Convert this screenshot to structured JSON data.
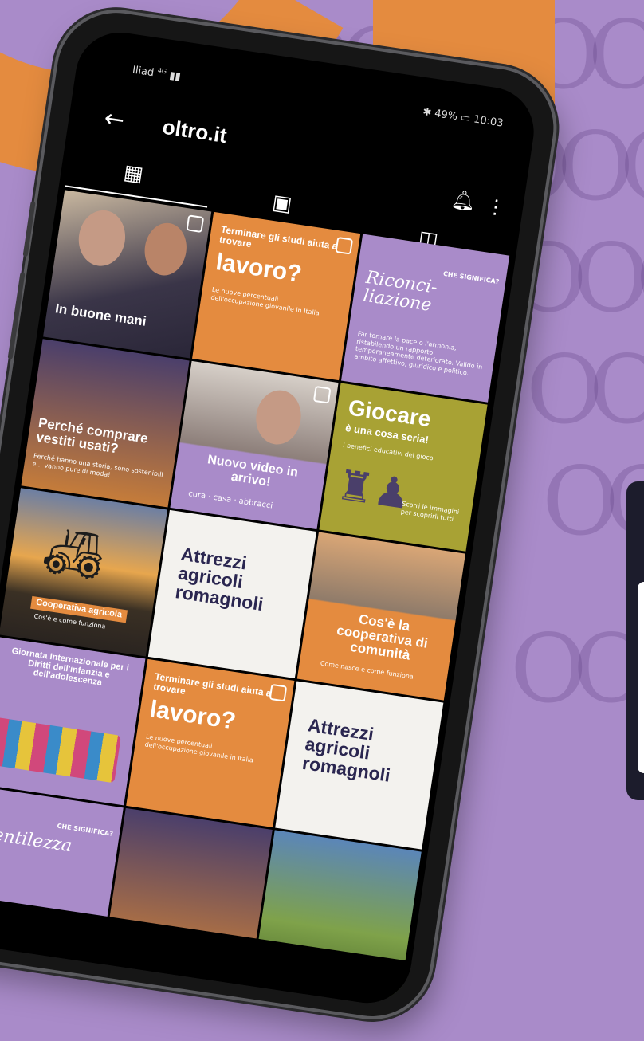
{
  "status_bar": {
    "carrier": "Iliad",
    "network": "4G",
    "battery": "49%",
    "time": "10:03"
  },
  "header": {
    "account_name": "oltro.it"
  },
  "tiles": [
    {
      "title": "In buone mani",
      "subtitle": ""
    },
    {
      "title": "lavoro?",
      "kicker": "Terminare gli studi aiuta a trovare",
      "subtitle": "Le nuove percentuali dell'occupazione giovanile in Italia"
    },
    {
      "title": "Riconci-liazione",
      "subtitle": "Far tornare la pace o l'armonia, ristabilendo un rapporto temporaneamente deteriorato. Valido in ambito affettivo, giuridico e politico.",
      "tag": "CHE SIGNIFICA?"
    },
    {
      "title": "Perché comprare vestiti usati?",
      "subtitle": "Perché hanno una storia, sono sostenibili e... vanno pure di moda!"
    },
    {
      "title": "Nuovo video in arrivo!",
      "subtitle": "cura · casa · abbracci"
    },
    {
      "title": "Giocare",
      "kicker": "è una cosa seria!",
      "subtitle": "I benefici educativi del gioco",
      "note": "Scorri le immagini per scoprirli tutti"
    },
    {
      "title": "Cooperativa agricola",
      "subtitle": "Cos'è e come funziona"
    },
    {
      "title": "Attrezzi agricoli romagnoli",
      "subtitle": ""
    },
    {
      "title": "Cos'è la cooperativa di comunità",
      "subtitle": "Come nasce e come funziona"
    },
    {
      "title": "Giornata Internazionale per i Diritti dell'infanzia e dell'adolescenza",
      "subtitle": ""
    },
    {
      "title": "lavoro?",
      "kicker": "Terminare gli studi aiuta a trovare",
      "subtitle": "Le nuove percentuali dell'occupazione giovanile in Italia"
    },
    {
      "title": "Attrezzi agricoli romagnoli",
      "subtitle": ""
    },
    {
      "title": "Gentilezza",
      "subtitle": "",
      "tag": "CHE SIGNIFICA?"
    },
    {
      "title": "",
      "subtitle": ""
    },
    {
      "title": "",
      "subtitle": ""
    }
  ],
  "colors": {
    "orange": "#e48b3f",
    "purple": "#a98bc9",
    "olive": "#a8a234",
    "dark": "#161616"
  }
}
